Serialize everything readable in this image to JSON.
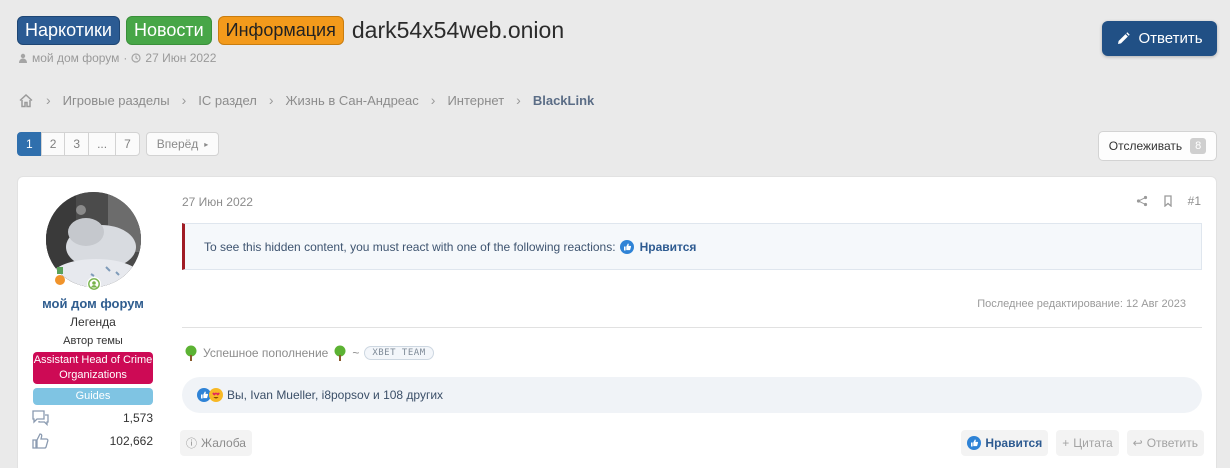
{
  "header": {
    "prefixes": [
      {
        "label": "Наркотики",
        "color": "#2b5b93"
      },
      {
        "label": "Новости",
        "color": "#47a647"
      },
      {
        "label": "Информация",
        "color": "#f39a1b"
      }
    ],
    "title": "dark54x54web.onion",
    "author": "мой дом форум",
    "date": "27 Июн 2022",
    "reply_label": "Ответить"
  },
  "breadcrumb": [
    "Игровые разделы",
    "IC раздел",
    "Жизнь в Сан-Андреас",
    "Интернет",
    "BlackLink"
  ],
  "pagination": {
    "pages": [
      "1",
      "2",
      "3",
      "...",
      "7"
    ],
    "active": "1",
    "next_label": "Вперёд"
  },
  "watch": {
    "label": "Отслеживать",
    "count": "8"
  },
  "post": {
    "user": {
      "name": "мой дом форум",
      "title": "Легенда",
      "op_label": "Автор темы",
      "banner_primary": "Assistant Head of Crime Organizations",
      "banner_secondary": "Guides",
      "messages": "1,573",
      "reactions": "102,662"
    },
    "date": "27 Июн 2022",
    "number": "#1",
    "hidden_notice": "To see this hidden content, you must react with one of the following reactions:",
    "required_reaction": "Нравится",
    "last_edit": "Последнее редактирование: 12 Авг 2023",
    "signature_text": "Успешное пополнение",
    "signature_tilde": "~",
    "signature_tag": "XBET TEAM",
    "reactions_text": "Вы, Ivan Mueller, i8popsov и 108 других",
    "report_label": "Жалоба",
    "like_label": "Нравится",
    "quote_label": "Цитата",
    "reply_label": "Ответить"
  },
  "colors": {
    "accent": "#215085",
    "banner_red": "#cd0a55",
    "banner_blue": "#7fc4e3",
    "hidden_border": "#a01c25"
  }
}
